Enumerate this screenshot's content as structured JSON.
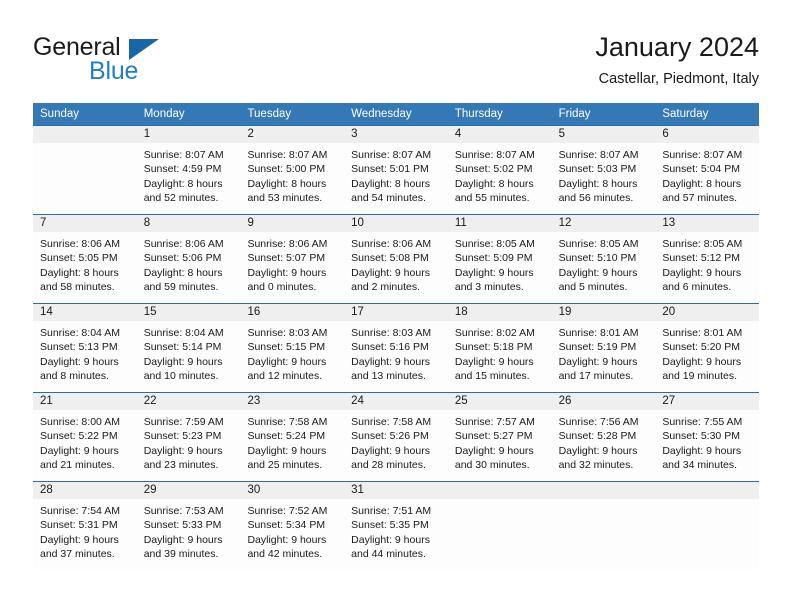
{
  "brand": {
    "name_part1": "General",
    "name_part2": "Blue",
    "flag_icon": "triangle-flag-icon"
  },
  "header": {
    "title": "January 2024",
    "subtitle": "Castellar, Piedmont, Italy"
  },
  "colors": {
    "header_band": "#3479b5",
    "week_separator": "#2c6ca5",
    "date_band": "#efefef",
    "brand_blue": "#1f7fc4",
    "brand_flag": "#1767a8",
    "text": "#1a1a1a"
  },
  "weekdays": [
    "Sunday",
    "Monday",
    "Tuesday",
    "Wednesday",
    "Thursday",
    "Friday",
    "Saturday"
  ],
  "weeks": [
    {
      "days": [
        {
          "date": "",
          "sunrise": "",
          "sunset": "",
          "daylight_l1": "",
          "daylight_l2": "",
          "empty": true
        },
        {
          "date": "1",
          "sunrise": "Sunrise: 8:07 AM",
          "sunset": "Sunset: 4:59 PM",
          "daylight_l1": "Daylight: 8 hours",
          "daylight_l2": "and 52 minutes.",
          "empty": false
        },
        {
          "date": "2",
          "sunrise": "Sunrise: 8:07 AM",
          "sunset": "Sunset: 5:00 PM",
          "daylight_l1": "Daylight: 8 hours",
          "daylight_l2": "and 53 minutes.",
          "empty": false
        },
        {
          "date": "3",
          "sunrise": "Sunrise: 8:07 AM",
          "sunset": "Sunset: 5:01 PM",
          "daylight_l1": "Daylight: 8 hours",
          "daylight_l2": "and 54 minutes.",
          "empty": false
        },
        {
          "date": "4",
          "sunrise": "Sunrise: 8:07 AM",
          "sunset": "Sunset: 5:02 PM",
          "daylight_l1": "Daylight: 8 hours",
          "daylight_l2": "and 55 minutes.",
          "empty": false
        },
        {
          "date": "5",
          "sunrise": "Sunrise: 8:07 AM",
          "sunset": "Sunset: 5:03 PM",
          "daylight_l1": "Daylight: 8 hours",
          "daylight_l2": "and 56 minutes.",
          "empty": false
        },
        {
          "date": "6",
          "sunrise": "Sunrise: 8:07 AM",
          "sunset": "Sunset: 5:04 PM",
          "daylight_l1": "Daylight: 8 hours",
          "daylight_l2": "and 57 minutes.",
          "empty": false
        }
      ]
    },
    {
      "days": [
        {
          "date": "7",
          "sunrise": "Sunrise: 8:06 AM",
          "sunset": "Sunset: 5:05 PM",
          "daylight_l1": "Daylight: 8 hours",
          "daylight_l2": "and 58 minutes.",
          "empty": false
        },
        {
          "date": "8",
          "sunrise": "Sunrise: 8:06 AM",
          "sunset": "Sunset: 5:06 PM",
          "daylight_l1": "Daylight: 8 hours",
          "daylight_l2": "and 59 minutes.",
          "empty": false
        },
        {
          "date": "9",
          "sunrise": "Sunrise: 8:06 AM",
          "sunset": "Sunset: 5:07 PM",
          "daylight_l1": "Daylight: 9 hours",
          "daylight_l2": "and 0 minutes.",
          "empty": false
        },
        {
          "date": "10",
          "sunrise": "Sunrise: 8:06 AM",
          "sunset": "Sunset: 5:08 PM",
          "daylight_l1": "Daylight: 9 hours",
          "daylight_l2": "and 2 minutes.",
          "empty": false
        },
        {
          "date": "11",
          "sunrise": "Sunrise: 8:05 AM",
          "sunset": "Sunset: 5:09 PM",
          "daylight_l1": "Daylight: 9 hours",
          "daylight_l2": "and 3 minutes.",
          "empty": false
        },
        {
          "date": "12",
          "sunrise": "Sunrise: 8:05 AM",
          "sunset": "Sunset: 5:10 PM",
          "daylight_l1": "Daylight: 9 hours",
          "daylight_l2": "and 5 minutes.",
          "empty": false
        },
        {
          "date": "13",
          "sunrise": "Sunrise: 8:05 AM",
          "sunset": "Sunset: 5:12 PM",
          "daylight_l1": "Daylight: 9 hours",
          "daylight_l2": "and 6 minutes.",
          "empty": false
        }
      ]
    },
    {
      "days": [
        {
          "date": "14",
          "sunrise": "Sunrise: 8:04 AM",
          "sunset": "Sunset: 5:13 PM",
          "daylight_l1": "Daylight: 9 hours",
          "daylight_l2": "and 8 minutes.",
          "empty": false
        },
        {
          "date": "15",
          "sunrise": "Sunrise: 8:04 AM",
          "sunset": "Sunset: 5:14 PM",
          "daylight_l1": "Daylight: 9 hours",
          "daylight_l2": "and 10 minutes.",
          "empty": false
        },
        {
          "date": "16",
          "sunrise": "Sunrise: 8:03 AM",
          "sunset": "Sunset: 5:15 PM",
          "daylight_l1": "Daylight: 9 hours",
          "daylight_l2": "and 12 minutes.",
          "empty": false
        },
        {
          "date": "17",
          "sunrise": "Sunrise: 8:03 AM",
          "sunset": "Sunset: 5:16 PM",
          "daylight_l1": "Daylight: 9 hours",
          "daylight_l2": "and 13 minutes.",
          "empty": false
        },
        {
          "date": "18",
          "sunrise": "Sunrise: 8:02 AM",
          "sunset": "Sunset: 5:18 PM",
          "daylight_l1": "Daylight: 9 hours",
          "daylight_l2": "and 15 minutes.",
          "empty": false
        },
        {
          "date": "19",
          "sunrise": "Sunrise: 8:01 AM",
          "sunset": "Sunset: 5:19 PM",
          "daylight_l1": "Daylight: 9 hours",
          "daylight_l2": "and 17 minutes.",
          "empty": false
        },
        {
          "date": "20",
          "sunrise": "Sunrise: 8:01 AM",
          "sunset": "Sunset: 5:20 PM",
          "daylight_l1": "Daylight: 9 hours",
          "daylight_l2": "and 19 minutes.",
          "empty": false
        }
      ]
    },
    {
      "days": [
        {
          "date": "21",
          "sunrise": "Sunrise: 8:00 AM",
          "sunset": "Sunset: 5:22 PM",
          "daylight_l1": "Daylight: 9 hours",
          "daylight_l2": "and 21 minutes.",
          "empty": false
        },
        {
          "date": "22",
          "sunrise": "Sunrise: 7:59 AM",
          "sunset": "Sunset: 5:23 PM",
          "daylight_l1": "Daylight: 9 hours",
          "daylight_l2": "and 23 minutes.",
          "empty": false
        },
        {
          "date": "23",
          "sunrise": "Sunrise: 7:58 AM",
          "sunset": "Sunset: 5:24 PM",
          "daylight_l1": "Daylight: 9 hours",
          "daylight_l2": "and 25 minutes.",
          "empty": false
        },
        {
          "date": "24",
          "sunrise": "Sunrise: 7:58 AM",
          "sunset": "Sunset: 5:26 PM",
          "daylight_l1": "Daylight: 9 hours",
          "daylight_l2": "and 28 minutes.",
          "empty": false
        },
        {
          "date": "25",
          "sunrise": "Sunrise: 7:57 AM",
          "sunset": "Sunset: 5:27 PM",
          "daylight_l1": "Daylight: 9 hours",
          "daylight_l2": "and 30 minutes.",
          "empty": false
        },
        {
          "date": "26",
          "sunrise": "Sunrise: 7:56 AM",
          "sunset": "Sunset: 5:28 PM",
          "daylight_l1": "Daylight: 9 hours",
          "daylight_l2": "and 32 minutes.",
          "empty": false
        },
        {
          "date": "27",
          "sunrise": "Sunrise: 7:55 AM",
          "sunset": "Sunset: 5:30 PM",
          "daylight_l1": "Daylight: 9 hours",
          "daylight_l2": "and 34 minutes.",
          "empty": false
        }
      ]
    },
    {
      "days": [
        {
          "date": "28",
          "sunrise": "Sunrise: 7:54 AM",
          "sunset": "Sunset: 5:31 PM",
          "daylight_l1": "Daylight: 9 hours",
          "daylight_l2": "and 37 minutes.",
          "empty": false
        },
        {
          "date": "29",
          "sunrise": "Sunrise: 7:53 AM",
          "sunset": "Sunset: 5:33 PM",
          "daylight_l1": "Daylight: 9 hours",
          "daylight_l2": "and 39 minutes.",
          "empty": false
        },
        {
          "date": "30",
          "sunrise": "Sunrise: 7:52 AM",
          "sunset": "Sunset: 5:34 PM",
          "daylight_l1": "Daylight: 9 hours",
          "daylight_l2": "and 42 minutes.",
          "empty": false
        },
        {
          "date": "31",
          "sunrise": "Sunrise: 7:51 AM",
          "sunset": "Sunset: 5:35 PM",
          "daylight_l1": "Daylight: 9 hours",
          "daylight_l2": "and 44 minutes.",
          "empty": false
        },
        {
          "date": "",
          "sunrise": "",
          "sunset": "",
          "daylight_l1": "",
          "daylight_l2": "",
          "empty": true
        },
        {
          "date": "",
          "sunrise": "",
          "sunset": "",
          "daylight_l1": "",
          "daylight_l2": "",
          "empty": true
        },
        {
          "date": "",
          "sunrise": "",
          "sunset": "",
          "daylight_l1": "",
          "daylight_l2": "",
          "empty": true
        }
      ]
    }
  ]
}
